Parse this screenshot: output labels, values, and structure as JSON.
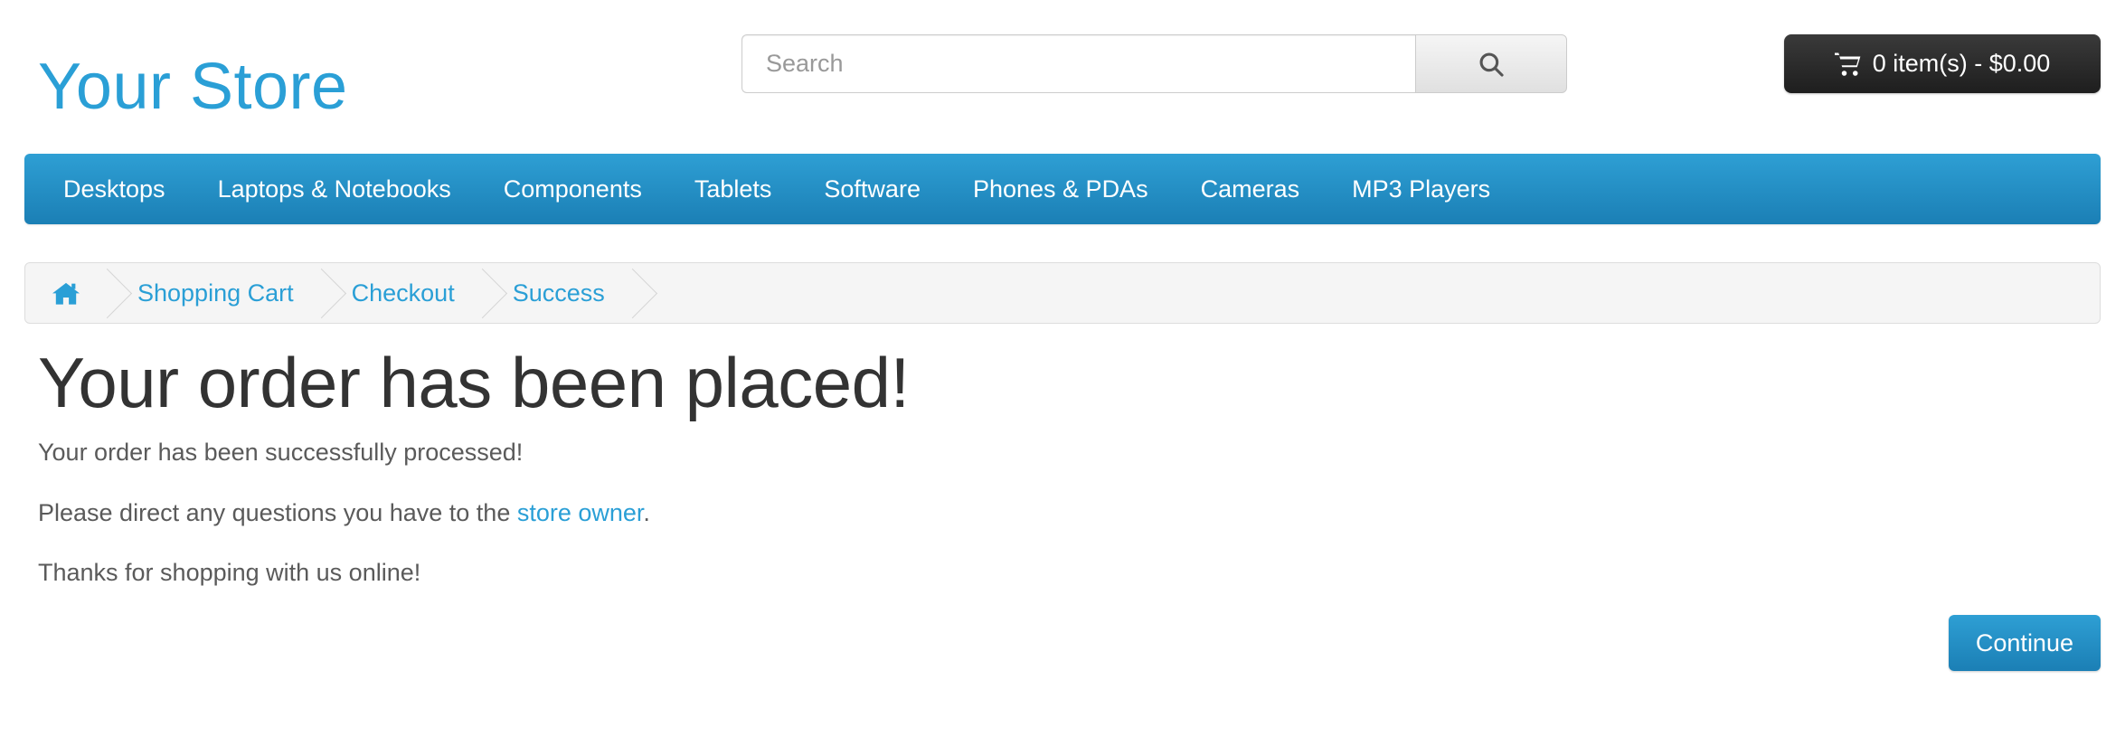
{
  "header": {
    "logo": "Your Store",
    "search": {
      "placeholder": "Search",
      "value": "",
      "button_icon": "search-icon"
    },
    "cart": {
      "icon": "shopping-cart-icon",
      "label": "0 item(s) - $0.00",
      "item_count": 0,
      "total": "$0.00"
    }
  },
  "nav": {
    "items": [
      {
        "label": "Desktops"
      },
      {
        "label": "Laptops & Notebooks"
      },
      {
        "label": "Components"
      },
      {
        "label": "Tablets"
      },
      {
        "label": "Software"
      },
      {
        "label": "Phones & PDAs"
      },
      {
        "label": "Cameras"
      },
      {
        "label": "MP3 Players"
      }
    ]
  },
  "breadcrumb": {
    "home_icon": "home-icon",
    "items": [
      {
        "label": "Shopping Cart"
      },
      {
        "label": "Checkout"
      },
      {
        "label": "Success"
      }
    ]
  },
  "main": {
    "title": "Your order has been placed!",
    "paragraph_1": "Your order has been successfully processed!",
    "paragraph_2_before": "Please direct any questions you have to the ",
    "paragraph_2_link": "store owner",
    "paragraph_2_after": ".",
    "paragraph_3": "Thanks for shopping with us online!"
  },
  "footer_actions": {
    "continue_label": "Continue"
  },
  "colors": {
    "brand_blue": "#2a9fd6",
    "nav_gradient_top": "#2e9fd4",
    "nav_gradient_bottom": "#1b7fb5",
    "cart_dark": "#1e1e1e",
    "breadcrumb_bg": "#f5f5f5",
    "text_dark": "#333333",
    "text_body": "#5a5a5a"
  }
}
